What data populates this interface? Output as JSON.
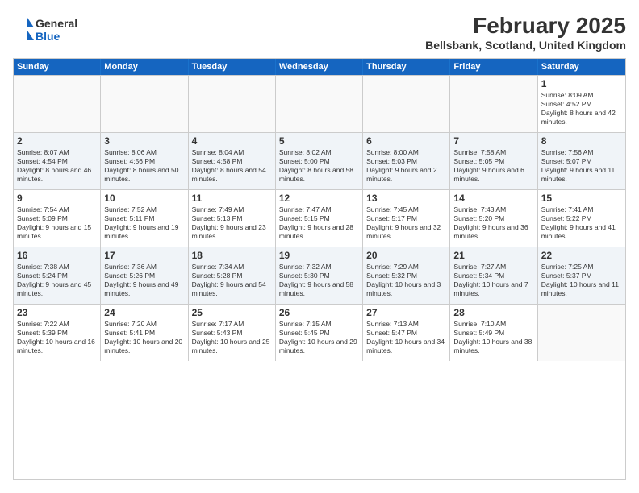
{
  "header": {
    "logo_line1": "General",
    "logo_line2": "Blue",
    "month_title": "February 2025",
    "location": "Bellsbank, Scotland, United Kingdom"
  },
  "weekdays": [
    "Sunday",
    "Monday",
    "Tuesday",
    "Wednesday",
    "Thursday",
    "Friday",
    "Saturday"
  ],
  "rows": [
    [
      {
        "day": "",
        "info": ""
      },
      {
        "day": "",
        "info": ""
      },
      {
        "day": "",
        "info": ""
      },
      {
        "day": "",
        "info": ""
      },
      {
        "day": "",
        "info": ""
      },
      {
        "day": "",
        "info": ""
      },
      {
        "day": "1",
        "info": "Sunrise: 8:09 AM\nSunset: 4:52 PM\nDaylight: 8 hours and 42 minutes."
      }
    ],
    [
      {
        "day": "2",
        "info": "Sunrise: 8:07 AM\nSunset: 4:54 PM\nDaylight: 8 hours and 46 minutes."
      },
      {
        "day": "3",
        "info": "Sunrise: 8:06 AM\nSunset: 4:56 PM\nDaylight: 8 hours and 50 minutes."
      },
      {
        "day": "4",
        "info": "Sunrise: 8:04 AM\nSunset: 4:58 PM\nDaylight: 8 hours and 54 minutes."
      },
      {
        "day": "5",
        "info": "Sunrise: 8:02 AM\nSunset: 5:00 PM\nDaylight: 8 hours and 58 minutes."
      },
      {
        "day": "6",
        "info": "Sunrise: 8:00 AM\nSunset: 5:03 PM\nDaylight: 9 hours and 2 minutes."
      },
      {
        "day": "7",
        "info": "Sunrise: 7:58 AM\nSunset: 5:05 PM\nDaylight: 9 hours and 6 minutes."
      },
      {
        "day": "8",
        "info": "Sunrise: 7:56 AM\nSunset: 5:07 PM\nDaylight: 9 hours and 11 minutes."
      }
    ],
    [
      {
        "day": "9",
        "info": "Sunrise: 7:54 AM\nSunset: 5:09 PM\nDaylight: 9 hours and 15 minutes."
      },
      {
        "day": "10",
        "info": "Sunrise: 7:52 AM\nSunset: 5:11 PM\nDaylight: 9 hours and 19 minutes."
      },
      {
        "day": "11",
        "info": "Sunrise: 7:49 AM\nSunset: 5:13 PM\nDaylight: 9 hours and 23 minutes."
      },
      {
        "day": "12",
        "info": "Sunrise: 7:47 AM\nSunset: 5:15 PM\nDaylight: 9 hours and 28 minutes."
      },
      {
        "day": "13",
        "info": "Sunrise: 7:45 AM\nSunset: 5:17 PM\nDaylight: 9 hours and 32 minutes."
      },
      {
        "day": "14",
        "info": "Sunrise: 7:43 AM\nSunset: 5:20 PM\nDaylight: 9 hours and 36 minutes."
      },
      {
        "day": "15",
        "info": "Sunrise: 7:41 AM\nSunset: 5:22 PM\nDaylight: 9 hours and 41 minutes."
      }
    ],
    [
      {
        "day": "16",
        "info": "Sunrise: 7:38 AM\nSunset: 5:24 PM\nDaylight: 9 hours and 45 minutes."
      },
      {
        "day": "17",
        "info": "Sunrise: 7:36 AM\nSunset: 5:26 PM\nDaylight: 9 hours and 49 minutes."
      },
      {
        "day": "18",
        "info": "Sunrise: 7:34 AM\nSunset: 5:28 PM\nDaylight: 9 hours and 54 minutes."
      },
      {
        "day": "19",
        "info": "Sunrise: 7:32 AM\nSunset: 5:30 PM\nDaylight: 9 hours and 58 minutes."
      },
      {
        "day": "20",
        "info": "Sunrise: 7:29 AM\nSunset: 5:32 PM\nDaylight: 10 hours and 3 minutes."
      },
      {
        "day": "21",
        "info": "Sunrise: 7:27 AM\nSunset: 5:34 PM\nDaylight: 10 hours and 7 minutes."
      },
      {
        "day": "22",
        "info": "Sunrise: 7:25 AM\nSunset: 5:37 PM\nDaylight: 10 hours and 11 minutes."
      }
    ],
    [
      {
        "day": "23",
        "info": "Sunrise: 7:22 AM\nSunset: 5:39 PM\nDaylight: 10 hours and 16 minutes."
      },
      {
        "day": "24",
        "info": "Sunrise: 7:20 AM\nSunset: 5:41 PM\nDaylight: 10 hours and 20 minutes."
      },
      {
        "day": "25",
        "info": "Sunrise: 7:17 AM\nSunset: 5:43 PM\nDaylight: 10 hours and 25 minutes."
      },
      {
        "day": "26",
        "info": "Sunrise: 7:15 AM\nSunset: 5:45 PM\nDaylight: 10 hours and 29 minutes."
      },
      {
        "day": "27",
        "info": "Sunrise: 7:13 AM\nSunset: 5:47 PM\nDaylight: 10 hours and 34 minutes."
      },
      {
        "day": "28",
        "info": "Sunrise: 7:10 AM\nSunset: 5:49 PM\nDaylight: 10 hours and 38 minutes."
      },
      {
        "day": "",
        "info": ""
      }
    ]
  ]
}
